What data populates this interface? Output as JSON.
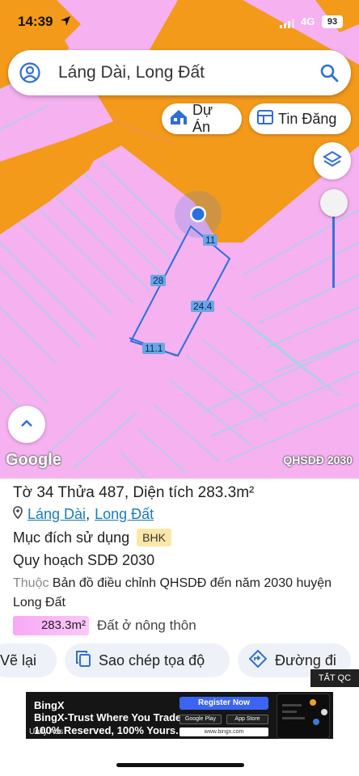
{
  "status_bar": {
    "time": "14:39",
    "network": "4G",
    "battery": "93"
  },
  "search": {
    "query": "Láng Dài, Long Đất"
  },
  "chips": [
    {
      "label": "Dự Án",
      "icon": "house-icon"
    },
    {
      "label": "Tin Đăng",
      "icon": "listing-icon"
    }
  ],
  "map": {
    "layer_name": "QHSDĐ 2030",
    "attribution": "Google",
    "colors": {
      "residential_land": "#f5b1f0",
      "road": "#f49a1a",
      "parcel_outline": "#4a90d9",
      "highlight": "#2a6fe0"
    },
    "parcel_dimensions": [
      "11",
      "28",
      "24.4",
      "11.1"
    ]
  },
  "info": {
    "title": "Tờ 34 Thửa 487, Diện tích 283.3m²",
    "location": {
      "commune": "Láng Dài",
      "sep": ",",
      "district": "Long Đất"
    },
    "purpose_label": "Mục đích sử dụng",
    "purpose_code": "BHK",
    "plan_label": "Quy hoạch SDĐ 2030",
    "source_prefix": "Thuộc",
    "source_text": "Bản đồ điều chỉnh QHSDĐ đến năm 2030 huyện Long Đất",
    "area_value": "283.3m²",
    "area_type": "Đất ở nông thôn"
  },
  "actions": [
    {
      "label": "Vẽ lại"
    },
    {
      "label": "Sao chép tọa độ"
    },
    {
      "label": "Đường đi"
    }
  ],
  "ad": {
    "close_label": "TẮT QC",
    "brand": "BingX",
    "headline": "BingX-Trust Where You Trade.",
    "tagline": "100% Reserved, 100% Yours.",
    "network": "Unity Ads",
    "cta": "Register Now",
    "store1": "Google Play",
    "store2": "App Store",
    "url": "www.bingx.com"
  }
}
